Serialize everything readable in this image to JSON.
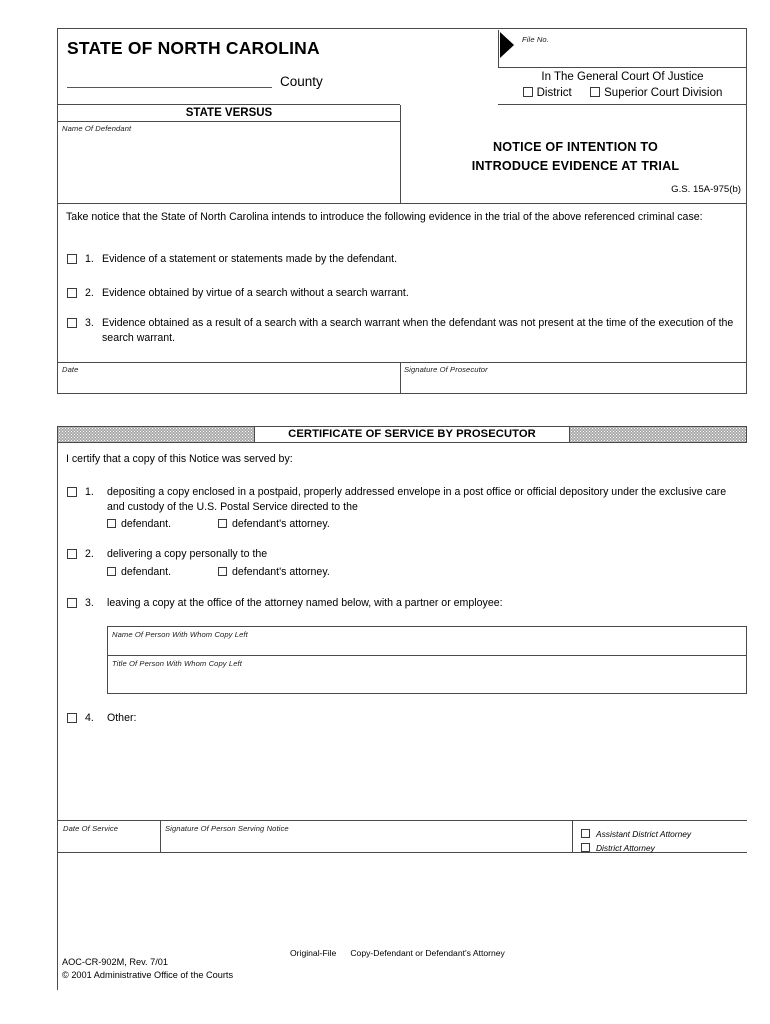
{
  "header": {
    "state_title": "STATE OF NORTH CAROLINA",
    "county_word": "County",
    "state_versus": "STATE VERSUS",
    "name_of_defendant_label": "Name Of Defendant",
    "file_no_label": "File No.",
    "court_line": "In The General Court Of Justice",
    "district_label": "District",
    "superior_label": "Superior Court Division",
    "notice_title_line1": "NOTICE OF INTENTION TO",
    "notice_title_line2": "INTRODUCE EVIDENCE AT TRIAL",
    "gs_citation": "G.S. 15A-975(b)"
  },
  "notice": {
    "intro": "Take notice that the State of North Carolina intends to introduce the following evidence in the trial of the above referenced criminal case:",
    "items": [
      {
        "num": "1.",
        "text": "Evidence of a statement or statements made by the defendant."
      },
      {
        "num": "2.",
        "text": "Evidence obtained by virtue of a search without a search warrant."
      },
      {
        "num": "3.",
        "text": "Evidence obtained as a result of a search with a search warrant when the defendant was not present at the time of the execution of the search warrant."
      }
    ],
    "date_label": "Date",
    "signature_of_prosecutor_label": "Signature Of Prosecutor"
  },
  "certificate": {
    "bar_title": "CERTIFICATE OF SERVICE BY PROSECUTOR",
    "certify_line": "I certify that a copy of this Notice was served by:",
    "items": [
      {
        "num": "1.",
        "text": "depositing a copy enclosed in a postpaid, properly addressed envelope in a post office or official depository under the exclusive care and custody of the U.S. Postal Service directed to the"
      },
      {
        "num": "2.",
        "text": "delivering a copy personally to the"
      },
      {
        "num": "3.",
        "text": "leaving a copy at the office of the attorney named below, with a partner or employee:"
      },
      {
        "num": "4.",
        "text": "Other:"
      }
    ],
    "sub_choices": {
      "defendant": "defendant.",
      "defendants_attorney": "defendant's attorney."
    },
    "name_of_person_label": "Name Of Person With Whom Copy Left",
    "title_of_person_label": "Title Of Person With Whom Copy Left"
  },
  "footer_row": {
    "date_of_service_label": "Date Of Service",
    "signature_of_person_serving_label": "Signature Of Person Serving Notice",
    "assistant_district_attorney": "Assistant District Attorney",
    "district_attorney": "District Attorney"
  },
  "page_footer": {
    "copy_original": "Original-File",
    "copy_defendant": "Copy-Defendant or Defendant's Attorney",
    "form_number": "AOC-CR-902M, Rev. 7/01",
    "copyright": "© 2001 Administrative Office of the Courts"
  }
}
